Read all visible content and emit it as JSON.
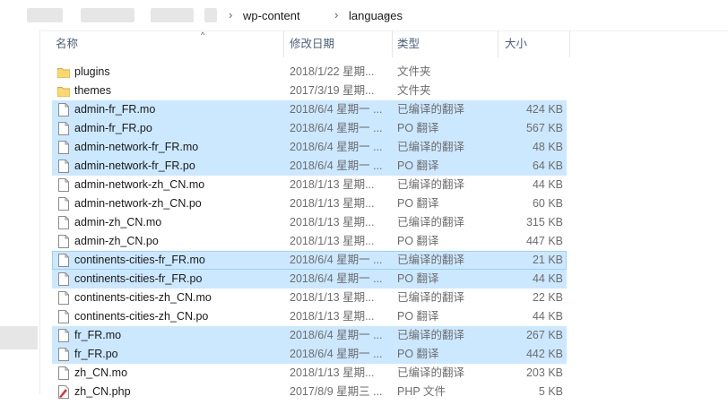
{
  "breadcrumb": [
    "wp-content",
    "languages"
  ],
  "header": {
    "name": "名称",
    "date": "修改日期",
    "type": "类型",
    "size": "大小"
  },
  "files": [
    {
      "name": "plugins",
      "date": "2018/1/22 星期...",
      "type": "文件夹",
      "size": "",
      "icon": "folder-icon",
      "selected": false
    },
    {
      "name": "themes",
      "date": "2017/3/19 星期...",
      "type": "文件夹",
      "size": "",
      "icon": "folder-icon",
      "selected": false
    },
    {
      "name": "admin-fr_FR.mo",
      "date": "2018/6/4 星期一 ...",
      "type": "已编译的翻译",
      "size": "424 KB",
      "icon": "file-icon",
      "selected": true
    },
    {
      "name": "admin-fr_FR.po",
      "date": "2018/6/4 星期一 ...",
      "type": "PO 翻译",
      "size": "567 KB",
      "icon": "file-icon",
      "selected": true
    },
    {
      "name": "admin-network-fr_FR.mo",
      "date": "2018/6/4 星期一 ...",
      "type": "已编译的翻译",
      "size": "48 KB",
      "icon": "file-icon",
      "selected": true
    },
    {
      "name": "admin-network-fr_FR.po",
      "date": "2018/6/4 星期一 ...",
      "type": "PO 翻译",
      "size": "64 KB",
      "icon": "file-icon",
      "selected": true
    },
    {
      "name": "admin-network-zh_CN.mo",
      "date": "2018/1/13 星期...",
      "type": "已编译的翻译",
      "size": "44 KB",
      "icon": "file-icon",
      "selected": false
    },
    {
      "name": "admin-network-zh_CN.po",
      "date": "2018/1/13 星期...",
      "type": "PO 翻译",
      "size": "60 KB",
      "icon": "file-icon",
      "selected": false
    },
    {
      "name": "admin-zh_CN.mo",
      "date": "2018/1/13 星期...",
      "type": "已编译的翻译",
      "size": "315 KB",
      "icon": "file-icon",
      "selected": false
    },
    {
      "name": "admin-zh_CN.po",
      "date": "2018/1/13 星期...",
      "type": "PO 翻译",
      "size": "447 KB",
      "icon": "file-icon",
      "selected": false
    },
    {
      "name": "continents-cities-fr_FR.mo",
      "date": "2018/6/4 星期一 ...",
      "type": "已编译的翻译",
      "size": "21 KB",
      "icon": "file-icon",
      "selected": true,
      "focused": true
    },
    {
      "name": "continents-cities-fr_FR.po",
      "date": "2018/6/4 星期一 ...",
      "type": "PO 翻译",
      "size": "44 KB",
      "icon": "file-icon",
      "selected": true
    },
    {
      "name": "continents-cities-zh_CN.mo",
      "date": "2018/1/13 星期...",
      "type": "已编译的翻译",
      "size": "22 KB",
      "icon": "file-icon",
      "selected": false
    },
    {
      "name": "continents-cities-zh_CN.po",
      "date": "2018/1/13 星期...",
      "type": "PO 翻译",
      "size": "44 KB",
      "icon": "file-icon",
      "selected": false
    },
    {
      "name": "fr_FR.mo",
      "date": "2018/6/4 星期一 ...",
      "type": "已编译的翻译",
      "size": "267 KB",
      "icon": "file-icon",
      "selected": true
    },
    {
      "name": "fr_FR.po",
      "date": "2018/6/4 星期一 ...",
      "type": "PO 翻译",
      "size": "442 KB",
      "icon": "file-icon",
      "selected": true
    },
    {
      "name": "zh_CN.mo",
      "date": "2018/1/13 星期...",
      "type": "已编译的翻译",
      "size": "203 KB",
      "icon": "file-icon",
      "selected": false
    },
    {
      "name": "zh_CN.php",
      "date": "2017/8/9 星期三 ...",
      "type": "PHP 文件",
      "size": "5 KB",
      "icon": "php-file-icon",
      "selected": false
    }
  ]
}
